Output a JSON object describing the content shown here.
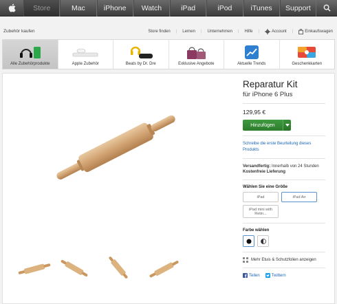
{
  "global_nav": {
    "items": [
      {
        "label": "Store",
        "active": true
      },
      {
        "label": "Mac"
      },
      {
        "label": "iPhone"
      },
      {
        "label": "Watch"
      },
      {
        "label": "iPad"
      },
      {
        "label": "iPod"
      },
      {
        "label": "iTunes"
      },
      {
        "label": "Support"
      }
    ]
  },
  "sub_nav": {
    "breadcrumb": "Zubehör kaufen",
    "links": [
      "Store finden",
      "Lernen",
      "Unternehmen",
      "Hilfe"
    ],
    "account": "Account",
    "cart": "Einkaufswagen"
  },
  "categories": [
    {
      "label": "Alle Zubehörprodukte",
      "active": true
    },
    {
      "label": "Apple Zubehör"
    },
    {
      "label": "Beats by Dr. Dre"
    },
    {
      "label": "Exklusive Angebote"
    },
    {
      "label": "Aktuelle Trends"
    },
    {
      "label": "Geschenkkarten"
    }
  ],
  "product": {
    "title": "Reparatur Kit",
    "subtitle": "für iPhone 6 Plus",
    "price": "129,95 €",
    "add_button": "Hinzufügen",
    "review_link": "Schreibe die erste Beurteilung dieses Produkts",
    "shipping_label": "Versandfertig:",
    "shipping_value": "Innerhalb von 24 Stunden",
    "free_delivery": "Kostenfreie Lieferung",
    "size_heading": "Wählen Sie eine Größe",
    "sizes": [
      "iPad",
      "iPad Air",
      "iPad mini with Retin..."
    ],
    "color_heading": "Farbe wählen",
    "more_cases": "Mehr Etuis & Schutzfolien anzeigen",
    "share": [
      "Teilen",
      "Twittern"
    ]
  },
  "colors": {
    "accent_green": "#2f8a2f",
    "link_blue": "#1b66b5",
    "nav_dark": "#3c3c3c"
  }
}
